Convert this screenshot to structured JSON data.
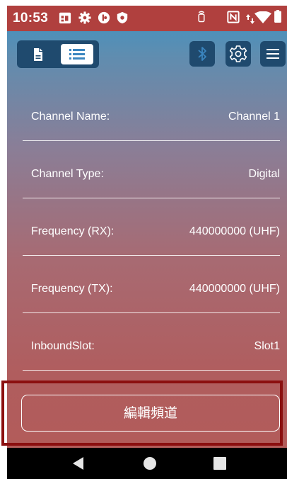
{
  "status_bar": {
    "time": "10:53",
    "left_icons": [
      "calendar-app-icon",
      "settings-gear-icon",
      "lastpass-icon",
      "shield-icon"
    ],
    "right_icons": [
      "nfc-tap-icon",
      "nfc-n-icon",
      "data-arrows-icon",
      "wifi-icon",
      "battery-icon"
    ]
  },
  "toolbar": {
    "view_toggle": {
      "options": [
        "document-view-icon",
        "list-view-icon"
      ],
      "selected": "list-view-icon"
    },
    "actions": [
      "bluetooth-icon",
      "settings-icon",
      "menu-icon"
    ]
  },
  "channel": {
    "rows": [
      {
        "label": "Channel Name:",
        "value": "Channel 1"
      },
      {
        "label": "Channel Type:",
        "value": "Digital"
      },
      {
        "label": "Frequency (RX):",
        "value": "440000000 (UHF)"
      },
      {
        "label": "Frequency (TX):",
        "value": "440000000 (UHF)"
      },
      {
        "label": "InboundSlot:",
        "value": "Slot1"
      }
    ]
  },
  "edit_button_label": "編輯頻道",
  "nav_bar": {
    "buttons": [
      "back-icon",
      "home-icon",
      "recents-icon"
    ]
  },
  "colors": {
    "status_bar": "#b0403e",
    "toolbar_button": "#1f4a6e",
    "gradient_top": "#3c93c3",
    "gradient_bottom": "#b25c5a",
    "highlight_frame": "#8b0f0f"
  }
}
